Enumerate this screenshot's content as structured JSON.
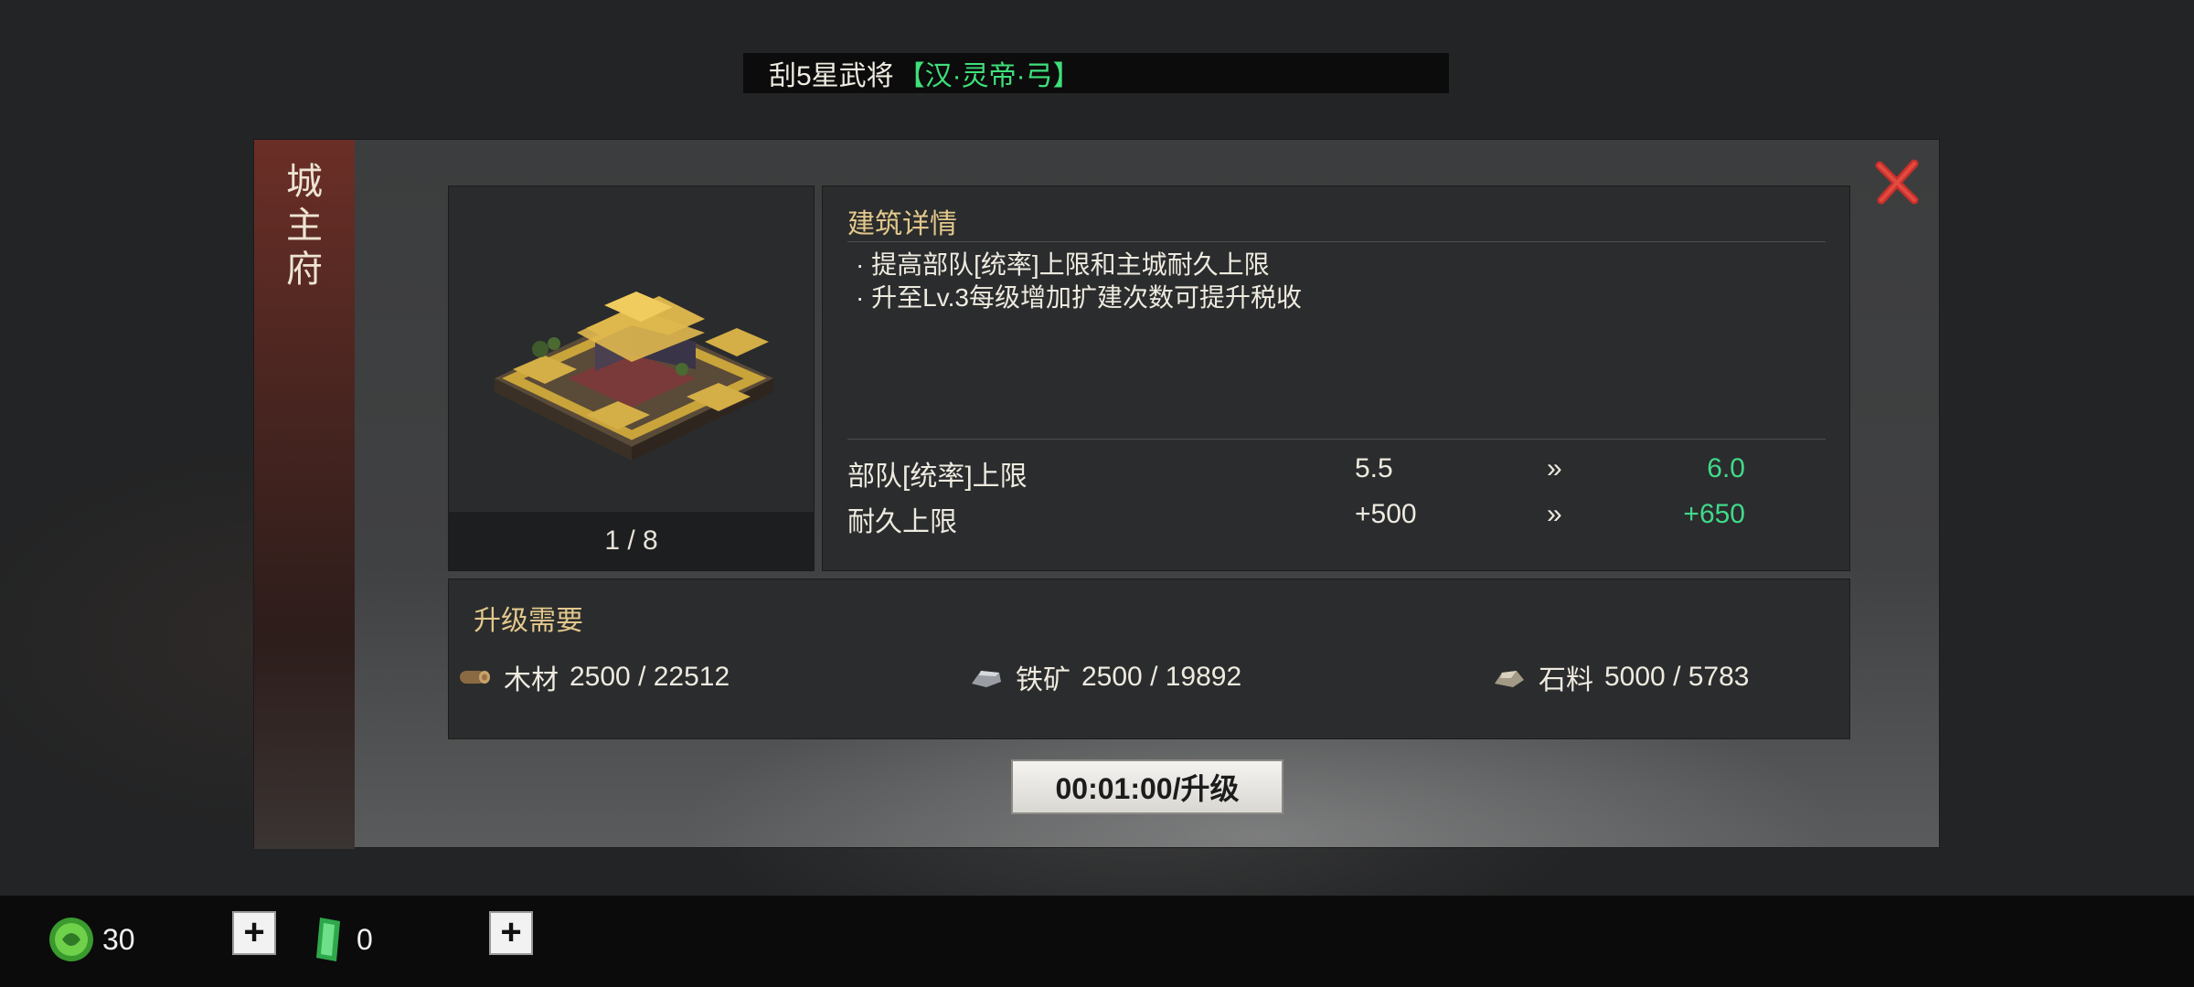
{
  "announcement": {
    "prefix": "刮5星武将",
    "hero": "【汉·灵帝·弓】"
  },
  "dialog": {
    "side_title": "城主府",
    "close_icon": "close-x-icon",
    "preview": {
      "pager": "1 / 8"
    },
    "details": {
      "heading": "建筑详情",
      "bullets": [
        "· 提高部队[统率]上限和主城耐久上限",
        "· 升至Lv.3每级增加扩建次数可提升税收"
      ],
      "stats": [
        {
          "label": "部队[统率]上限",
          "current": "5.5",
          "arrow": "»",
          "next": "6.0"
        },
        {
          "label": "耐久上限",
          "current": "+500",
          "arrow": "»",
          "next": "+650"
        }
      ]
    },
    "requirements": {
      "heading": "升级需要",
      "items": [
        {
          "icon": "wood-log-icon",
          "name": "木材",
          "amount": "2500 / 22512"
        },
        {
          "icon": "iron-ore-icon",
          "name": "铁矿",
          "amount": "2500 / 19892"
        },
        {
          "icon": "stone-icon",
          "name": "石料",
          "amount": "5000 / 5783"
        }
      ]
    },
    "upgrade_button": "00:01:00/升级"
  },
  "currency": [
    {
      "icon": "jade-coin-icon",
      "value": "30"
    },
    {
      "icon": "green-jade-token-icon",
      "value": "0"
    }
  ],
  "colors": {
    "accent_green": "#40d98a",
    "heading_gold": "#e2c88c",
    "close_red": "#c8302a"
  }
}
